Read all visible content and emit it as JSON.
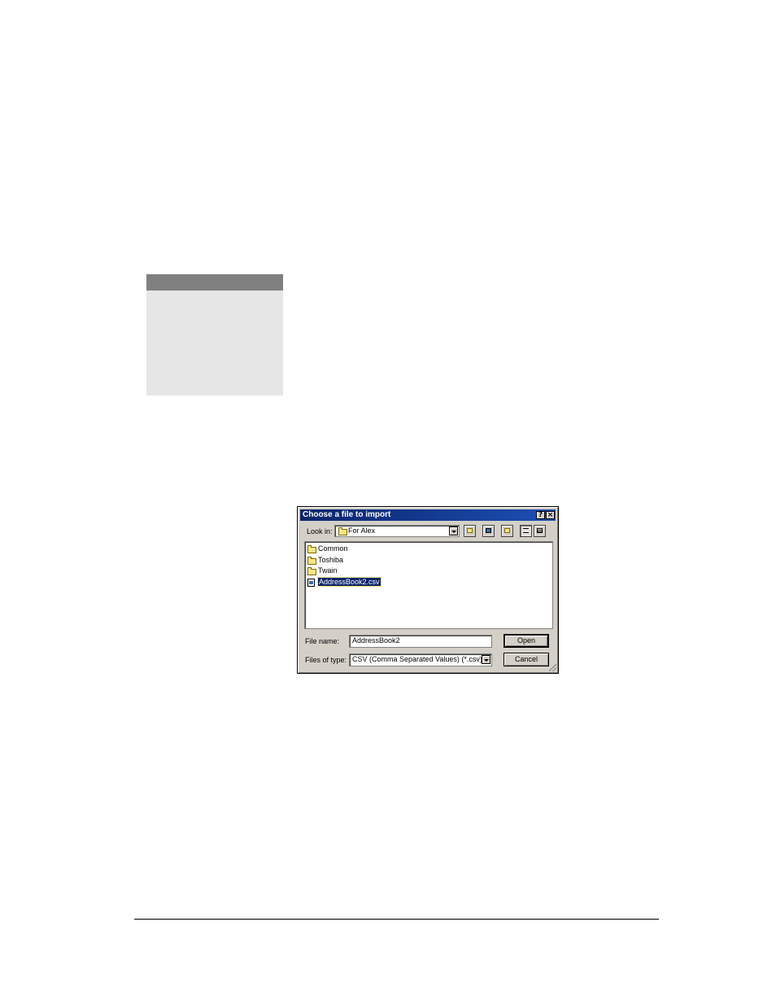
{
  "dialog": {
    "title": "Choose a file to import",
    "look_in_label": "Look in:",
    "look_in_value": "For Alex",
    "toolbar_icons": [
      "up-folder-icon",
      "desktop-icon",
      "new-folder-icon",
      "list-view-icon",
      "details-view-icon"
    ],
    "items": [
      {
        "name": "Common",
        "type": "folder"
      },
      {
        "name": "Toshiba",
        "type": "folder"
      },
      {
        "name": "Twain",
        "type": "folder"
      },
      {
        "name": "AddressBook2.csv",
        "type": "file",
        "selected": true
      }
    ],
    "file_name_label": "File name:",
    "file_name_value": "AddressBook2",
    "files_of_type_label": "Files of type:",
    "files_of_type_value": "CSV (Comma Separated Values) (*.csv)",
    "open_label": "Open",
    "cancel_label": "Cancel",
    "help_glyph": "?",
    "close_glyph": "×",
    "colors": {
      "titlebar": "#0a246a",
      "selection": "#0a246a",
      "face": "#d4d0c8"
    }
  }
}
